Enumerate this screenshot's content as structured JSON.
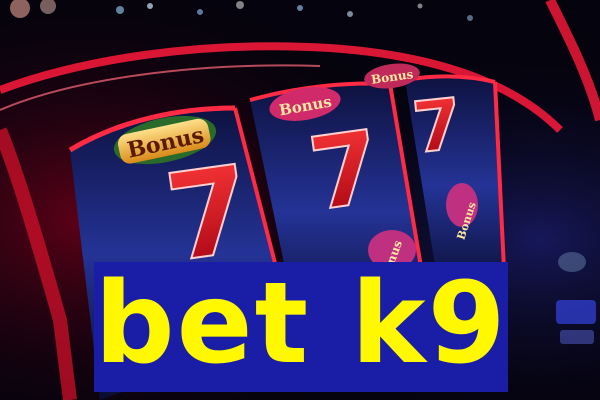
{
  "banner": {
    "text": "bet k9"
  },
  "reels": [
    {
      "top_symbol": "Bonus",
      "main_symbol": "7"
    },
    {
      "top_symbol": "Bonus",
      "main_symbol": "7",
      "lower_symbol": "Bonus"
    },
    {
      "top_symbol": "Bonus",
      "main_symbol": "7",
      "lower_symbol": "Bonus"
    }
  ],
  "colors": {
    "banner_background": "#1a1ea6",
    "banner_text": "#fff800",
    "neon_red": "#ff1a3c",
    "seven_red": "#e01020",
    "reel_blue": "#1c2a8a"
  }
}
